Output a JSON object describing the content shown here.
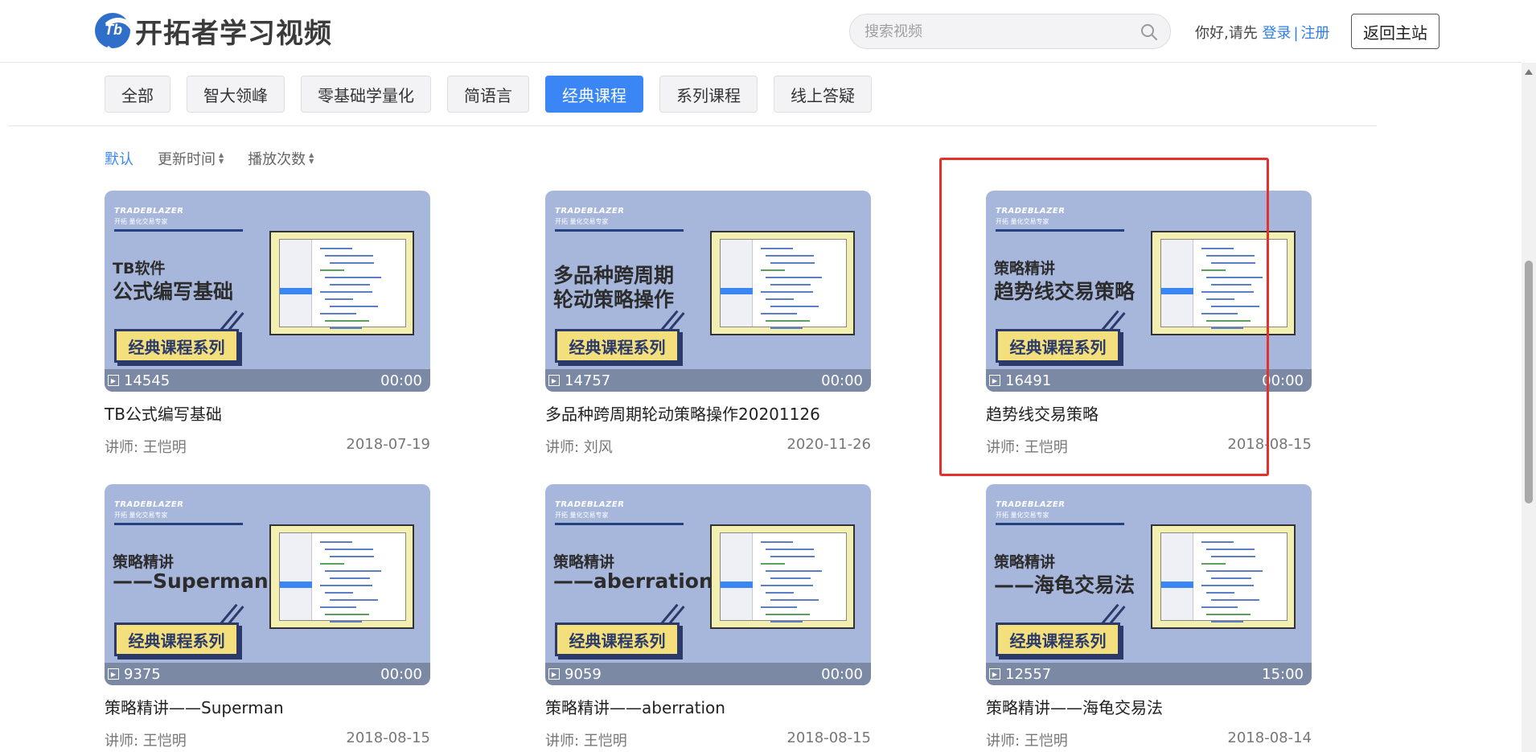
{
  "header": {
    "logo_mark": "Tb",
    "logo_text": "开拓者学习视频",
    "search_placeholder": "搜索视频",
    "greeting": "你好,请先",
    "login": "登录",
    "separator": "|",
    "register": "注册",
    "back_label": "返回主站"
  },
  "tabs": [
    {
      "label": "全部",
      "active": false
    },
    {
      "label": "智大领峰",
      "active": false
    },
    {
      "label": "零基础学量化",
      "active": false
    },
    {
      "label": "简语言",
      "active": false
    },
    {
      "label": "经典课程",
      "active": true
    },
    {
      "label": "系列课程",
      "active": false
    },
    {
      "label": "线上答疑",
      "active": false
    }
  ],
  "sorts": [
    {
      "label": "默认",
      "active": true
    },
    {
      "label": "更新时间",
      "active": false
    },
    {
      "label": "播放次数",
      "active": false
    }
  ],
  "thumb_common": {
    "brand": "TRADEBLAZER",
    "brand_sub": "开拓 量化交易专家",
    "series": "经典课程系列"
  },
  "cards": [
    {
      "thumb_line1": "TB软件",
      "thumb_line2": "公式编写基础",
      "views": "14545",
      "duration": "00:00",
      "title": "TB公式编写基础",
      "teacher": "讲师: 王恺明",
      "date": "2018-07-19"
    },
    {
      "thumb_line1": "多品种跨周期",
      "thumb_line2": "轮动策略操作",
      "views": "14757",
      "duration": "00:00",
      "title": "多品种跨周期轮动策略操作20201126",
      "teacher": "讲师: 刘风",
      "date": "2020-11-26"
    },
    {
      "thumb_line1": "策略精讲",
      "thumb_line2": "趋势线交易策略",
      "views": "16491",
      "duration": "00:00",
      "title": "趋势线交易策略",
      "teacher": "讲师: 王恺明",
      "date": "2018-08-15"
    },
    {
      "thumb_line1": "策略精讲",
      "thumb_line2": "——Superman",
      "views": "9375",
      "duration": "00:00",
      "title": "策略精讲——Superman",
      "teacher": "讲师: 王恺明",
      "date": "2018-08-15"
    },
    {
      "thumb_line1": "策略精讲",
      "thumb_line2": "——aberration",
      "views": "9059",
      "duration": "00:00",
      "title": "策略精讲——aberration",
      "teacher": "讲师: 王恺明",
      "date": "2018-08-15"
    },
    {
      "thumb_line1": "策略精讲",
      "thumb_line2": "——海龟交易法",
      "views": "12557",
      "duration": "15:00",
      "title": "策略精讲——海龟交易法",
      "teacher": "讲师: 王恺明",
      "date": "2018-08-14"
    }
  ],
  "colors": {
    "accent": "#3a86f5",
    "highlight": "#e5302b",
    "thumb_bg": "#a7b7dc",
    "series_badge": "#f3e07c"
  }
}
